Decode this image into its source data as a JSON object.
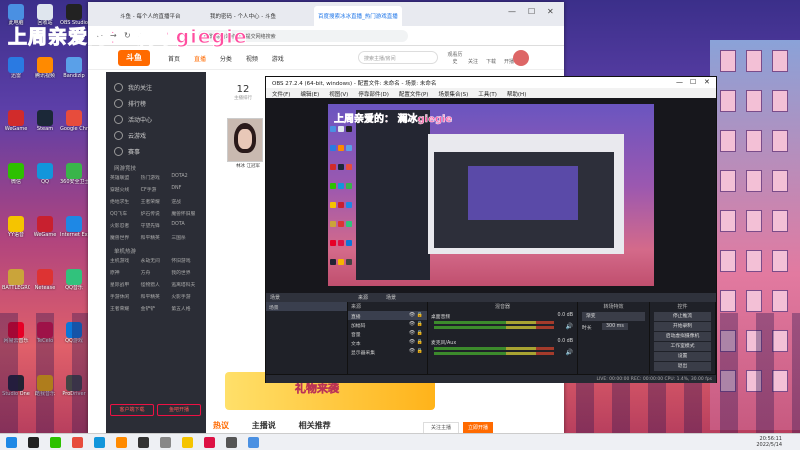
{
  "overlay_text": "上周亲爱的：  澜冰giegie",
  "desktop_icons": [
    {
      "label": "此电脑",
      "color": "#4a90e2"
    },
    {
      "label": "回收站",
      "color": "#dfe6ee"
    },
    {
      "label": "OBS Studio",
      "color": "#222"
    },
    {
      "label": "迅雷",
      "color": "#2a7ae2"
    },
    {
      "label": "腾讯视频",
      "color": "#ff8a00"
    },
    {
      "label": "Bandizip",
      "color": "#5aa0e8"
    },
    {
      "label": "WeGame",
      "color": "#d12b2b"
    },
    {
      "label": "Steam",
      "color": "#1b2838"
    },
    {
      "label": "Google Chrome",
      "color": "#e74c3c"
    },
    {
      "label": "微信",
      "color": "#2dc100"
    },
    {
      "label": "QQ",
      "color": "#1296db"
    },
    {
      "label": "360安全卫士",
      "color": "#39b54a"
    },
    {
      "label": "YY语音",
      "color": "#f5c400"
    },
    {
      "label": "WeGame",
      "color": "#c8202f"
    },
    {
      "label": "Internet Explorer",
      "color": "#1e88e5"
    },
    {
      "label": "BATTLEGRO",
      "color": "#caa43a"
    },
    {
      "label": "Netease",
      "color": "#d33"
    },
    {
      "label": "QQ音乐",
      "color": "#31c27c"
    },
    {
      "label": "网易云音乐",
      "color": "#e60026"
    },
    {
      "label": "TeCelo",
      "color": "#d14"
    },
    {
      "label": "QQ游戏",
      "color": "#0b76d8"
    },
    {
      "label": "Studio One",
      "color": "#223"
    },
    {
      "label": "酷我音乐",
      "color": "#f7b500"
    },
    {
      "label": "ProDriver",
      "color": "#444"
    }
  ],
  "browser": {
    "tabs": [
      {
        "label": "斗鱼 - 每个人的直播平台"
      },
      {
        "label": "我的密码 - 个人中心 - 斗鱼"
      },
      {
        "label": "百度搜索冰冰直播_热门游戏直播"
      }
    ],
    "url": "电影 综合站点中华提交网络搜索",
    "site": {
      "logo": "斗鱼",
      "nav": [
        "首页",
        "直播",
        "分类",
        "视频",
        "游戏"
      ],
      "search_placeholder": "搜索主播/房间",
      "header_icons": [
        "观看历史",
        "关注",
        "下载",
        "开播"
      ],
      "sidebar": {
        "items": [
          "我的关注",
          "排行榜",
          "活动中心",
          "云游戏",
          "赛事"
        ],
        "section_title": "网游竞技",
        "categories": [
          "英雄联盟",
          "热门游戏",
          "DOTA2",
          "穿越火线",
          "CF手游",
          "DNF",
          "绝地求生",
          "王者荣耀",
          "逆战",
          "QQ飞车",
          "炉石传说",
          "魔兽怀旧服",
          "火影忍者",
          "守望先锋",
          "DOTA",
          "魔兽世界",
          "和平精英",
          "三国杀"
        ],
        "section2": "单机热游",
        "categories2": [
          "主机游戏",
          "永劫无间",
          "怀旧游戏",
          "原神",
          "方舟",
          "我的世界",
          "星际战甲",
          "怪物猎人",
          "逃离塔科夫",
          "手游休闲",
          "和平精英",
          "火影手游",
          "王者荣耀",
          "金铲铲",
          "第五人格"
        ],
        "btn_left": "客户端下载",
        "btn_right": "鱼吧开播"
      },
      "streamer_count": "12",
      "streamer_sub": "主播排行",
      "streamer_name": "林冰 江冠军",
      "promo_text": "礼物来袭",
      "bottom_tabs": [
        "热议",
        "主播说",
        "相关推荐"
      ],
      "follow_btn": "关注主播",
      "orange_btn": "立即开播"
    }
  },
  "obs": {
    "title": "OBS 27.2.4 (64-bit, windows) - 配置文件: 未命名 - 场景: 未命名",
    "menu": [
      "文件(F)",
      "编辑(E)",
      "视图(V)",
      "停靠部件(D)",
      "配置文件(P)",
      "场景集合(S)",
      "工具(T)",
      "帮助(H)"
    ],
    "preview_overlay": "上周亲爱的：  澜冰giegie",
    "docks": {
      "scenes_header": "场景",
      "scenes": [
        "场景"
      ],
      "sources_header": "来源",
      "sources": [
        "直播",
        "加幅码",
        "音量",
        "文本",
        "显示器采集"
      ],
      "mixer_header": "混音器",
      "mixer": [
        {
          "name": "桌面音频",
          "db": "0.0 dB"
        },
        {
          "name": "麦克风/Aux",
          "db": "0.0 dB"
        }
      ],
      "transitions_header": "转场特效",
      "transition": "渐变",
      "duration_label": "时长",
      "duration": "300 ms",
      "controls_header": "控件",
      "controls": [
        "停止推流",
        "开始录制",
        "启动虚拟摄像机",
        "工作室模式",
        "设置",
        "退出"
      ],
      "dock_tabs_left": "来源",
      "dock_tabs_right": "场景"
    },
    "status": "LIVE: 00:00:00   REC: 00:00:00   CPU: 1.4%, 30.00 fps"
  },
  "taskbar": {
    "time": "20:56:11",
    "date": "2022/5/14",
    "icons": [
      "#1e88e5",
      "#222",
      "#2dc100",
      "#e74c3c",
      "#1296db",
      "#ff8a00",
      "#333",
      "#888",
      "#f5c400",
      "#d14",
      "#555",
      "#4a90e2"
    ]
  }
}
